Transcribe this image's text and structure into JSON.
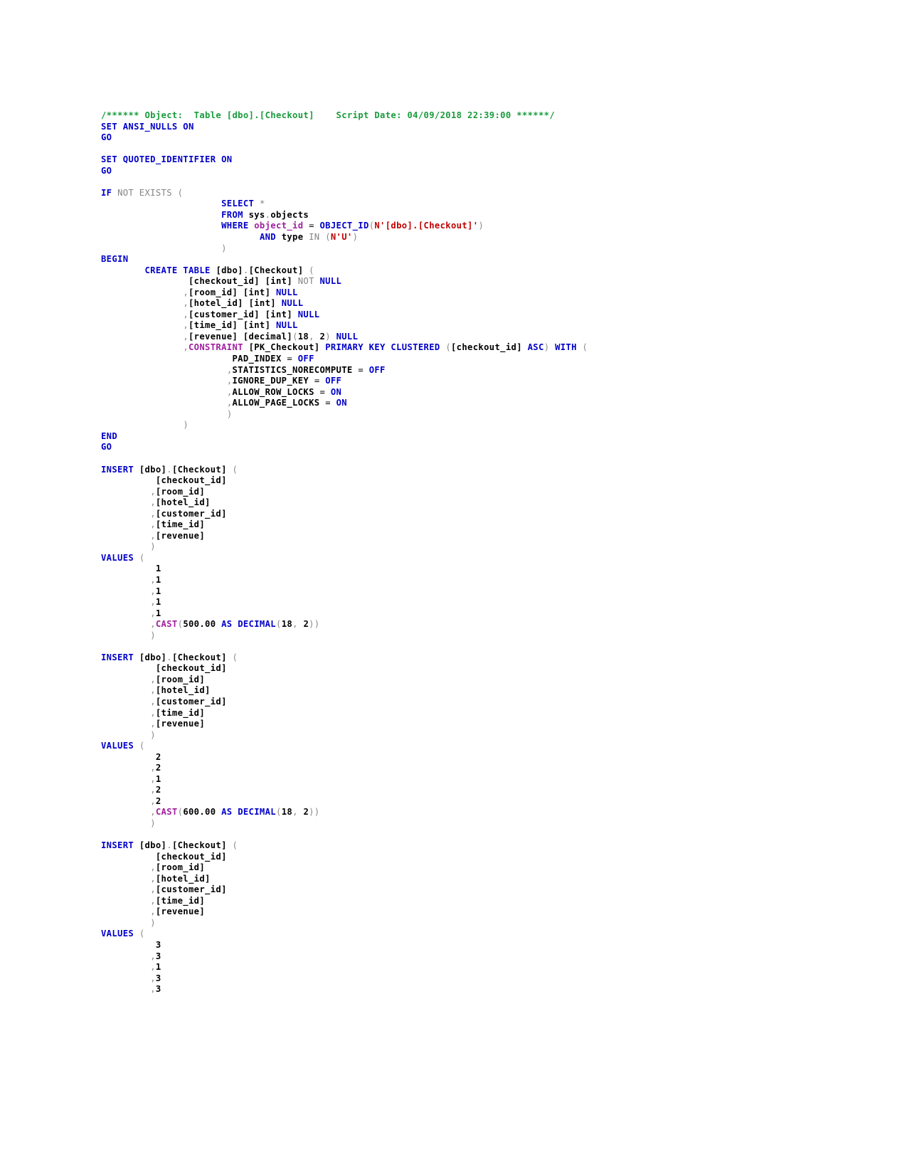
{
  "document": {
    "type": "sql-script",
    "language": "T-SQL",
    "object_name": "[dbo].[Checkout]",
    "script_date": "04/09/2018 22:39:00",
    "header_comment": "/****** Object:  Table [dbo].[Checkout]    Script Date: 04/09/2018 22:39:00 ******/"
  },
  "colors": {
    "comment": "#1a9c3c",
    "keyword": "#0000C8",
    "gray_keyword": "#848484",
    "function": "#A020A0",
    "string": "#C00000",
    "identifier": "#000000",
    "punctuation": "#8a8a8a",
    "background": "#ffffff"
  },
  "settings": {
    "ansi_nulls": "SET ANSI_NULLS ON",
    "quoted_identifier": "SET QUOTED_IDENTIFIER ON",
    "batch_separator": "GO"
  },
  "existence_check": {
    "statement": "IF NOT EXISTS (",
    "select": "SELECT *",
    "from": "FROM sys.objects",
    "where": "WHERE object_id = OBJECT_ID(N'[dbo].[Checkout]')",
    "and": "AND type IN (N'U')",
    "object_id_literal": "N'[dbo].[Checkout]'",
    "type_literal": "N'U'"
  },
  "create_table": {
    "begin": "BEGIN",
    "end": "END",
    "statement": "CREATE TABLE [dbo].[Checkout] (",
    "schema": "[dbo]",
    "table": "[Checkout]",
    "columns": [
      {
        "name": "[checkout_id]",
        "type": "[int]",
        "nullability": "NOT NULL",
        "leading_comma": false
      },
      {
        "name": "[room_id]",
        "type": "[int]",
        "nullability": "NULL",
        "leading_comma": true
      },
      {
        "name": "[hotel_id]",
        "type": "[int]",
        "nullability": "NULL",
        "leading_comma": true
      },
      {
        "name": "[customer_id]",
        "type": "[int]",
        "nullability": "NULL",
        "leading_comma": true
      },
      {
        "name": "[time_id]",
        "type": "[int]",
        "nullability": "NULL",
        "leading_comma": true
      },
      {
        "name": "[revenue]",
        "type": "[decimal](18, 2)",
        "nullability": "NULL",
        "leading_comma": true
      }
    ],
    "constraint": {
      "name": "[PK_Checkout]",
      "keyword": "CONSTRAINT",
      "type": "PRIMARY KEY CLUSTERED",
      "key_column": "[checkout_id]",
      "sort_order": "ASC",
      "with": "WITH ("
    },
    "index_options": [
      {
        "name": "PAD_INDEX",
        "value": "OFF",
        "leading_comma": false
      },
      {
        "name": "STATISTICS_NORECOMPUTE",
        "value": "OFF",
        "leading_comma": true
      },
      {
        "name": "IGNORE_DUP_KEY",
        "value": "OFF",
        "leading_comma": true
      },
      {
        "name": "ALLOW_ROW_LOCKS",
        "value": "ON",
        "leading_comma": true
      },
      {
        "name": "ALLOW_PAGE_LOCKS",
        "value": "ON",
        "leading_comma": true
      }
    ]
  },
  "insert_column_list": [
    {
      "name": "[checkout_id]",
      "leading_comma": false
    },
    {
      "name": "[room_id]",
      "leading_comma": true
    },
    {
      "name": "[hotel_id]",
      "leading_comma": true
    },
    {
      "name": "[customer_id]",
      "leading_comma": true
    },
    {
      "name": "[time_id]",
      "leading_comma": true
    },
    {
      "name": "[revenue]",
      "leading_comma": true
    }
  ],
  "inserts": [
    {
      "statement": "INSERT [dbo].[Checkout] (",
      "values_keyword": "VALUES (",
      "values": [
        {
          "text": "1",
          "leading_comma": false,
          "is_cast": false
        },
        {
          "text": "1",
          "leading_comma": true,
          "is_cast": false
        },
        {
          "text": "1",
          "leading_comma": true,
          "is_cast": false
        },
        {
          "text": "1",
          "leading_comma": true,
          "is_cast": false
        },
        {
          "text": "1",
          "leading_comma": true,
          "is_cast": false
        },
        {
          "text": "CAST(500.00 AS DECIMAL(18, 2))",
          "leading_comma": true,
          "is_cast": true,
          "cast_amount": "500.00",
          "cast_precision": "18",
          "cast_scale": "2"
        }
      ]
    },
    {
      "statement": "INSERT [dbo].[Checkout] (",
      "values_keyword": "VALUES (",
      "values": [
        {
          "text": "2",
          "leading_comma": false,
          "is_cast": false
        },
        {
          "text": "2",
          "leading_comma": true,
          "is_cast": false
        },
        {
          "text": "1",
          "leading_comma": true,
          "is_cast": false
        },
        {
          "text": "2",
          "leading_comma": true,
          "is_cast": false
        },
        {
          "text": "2",
          "leading_comma": true,
          "is_cast": false
        },
        {
          "text": "CAST(600.00 AS DECIMAL(18, 2))",
          "leading_comma": true,
          "is_cast": true,
          "cast_amount": "600.00",
          "cast_precision": "18",
          "cast_scale": "2"
        }
      ]
    },
    {
      "statement": "INSERT [dbo].[Checkout] (",
      "values_keyword": "VALUES (",
      "values": [
        {
          "text": "3",
          "leading_comma": false,
          "is_cast": false
        },
        {
          "text": "3",
          "leading_comma": true,
          "is_cast": false
        },
        {
          "text": "1",
          "leading_comma": true,
          "is_cast": false
        },
        {
          "text": "3",
          "leading_comma": true,
          "is_cast": false
        },
        {
          "text": "3",
          "leading_comma": true,
          "is_cast": false
        }
      ]
    }
  ],
  "tokens": {
    "set": "SET",
    "go": "GO",
    "if": "IF",
    "not": "NOT",
    "exists": "EXISTS",
    "select": "SELECT",
    "star": "*",
    "from": "FROM",
    "sys": "sys",
    "dot": ".",
    "objects": "objects",
    "where": "WHERE",
    "object_id_col": "object_id",
    "equals": "=",
    "object_id_fn": "OBJECT_ID",
    "and": "AND",
    "type": "type",
    "in": "IN",
    "begin": "BEGIN",
    "end": "END",
    "create": "CREATE",
    "table": "TABLE",
    "null": "NULL",
    "not_null": "NOT",
    "constraint": "CONSTRAINT",
    "primary_key_clustered": "PRIMARY KEY CLUSTERED",
    "asc": "ASC",
    "with": "WITH",
    "insert": "INSERT",
    "values": "VALUES",
    "cast": "CAST",
    "as": "AS",
    "decimal": "DECIMAL",
    "open_paren": "(",
    "close_paren": ")",
    "comma": ",",
    "ansi_nulls": "ANSI_NULLS",
    "quoted_identifier": "QUOTED_IDENTIFIER",
    "on": "ON",
    "off": "OFF",
    "int_type": "[int]",
    "decimal_type": "[decimal]",
    "eighteen": "18",
    "two": "2"
  }
}
